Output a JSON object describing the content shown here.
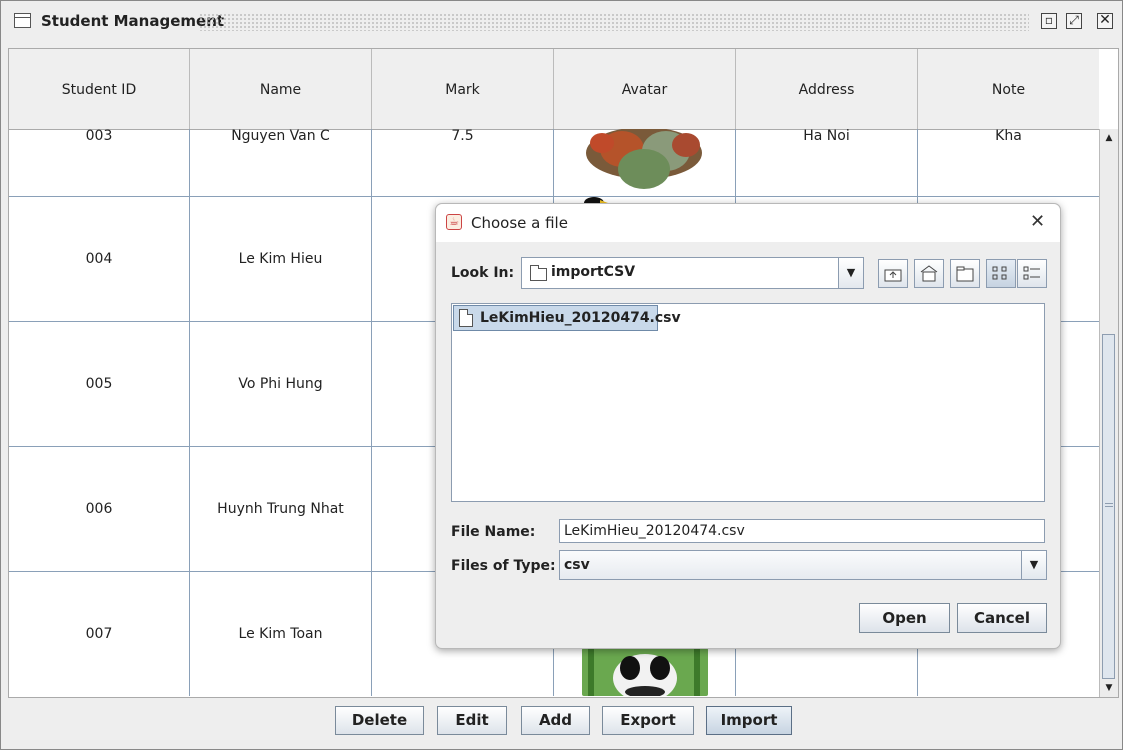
{
  "window": {
    "title": "Student Management",
    "controls": {
      "iconify": "▫",
      "maximize": "⤢",
      "close": "✕"
    }
  },
  "table": {
    "columns": [
      "Student ID",
      "Name",
      "Mark",
      "Avatar",
      "Address",
      "Note"
    ],
    "rows": [
      {
        "id": "003",
        "name": "Nguyen Van C",
        "mark": "7.5",
        "address": "Ha Noi",
        "note": "Kha"
      },
      {
        "id": "004",
        "name": "Le Kim Hieu",
        "mark": "",
        "address": "",
        "note": ""
      },
      {
        "id": "005",
        "name": "Vo Phi Hung",
        "mark": "",
        "address": "",
        "note": ""
      },
      {
        "id": "006",
        "name": "Huynh Trung Nhat",
        "mark": "",
        "address": "",
        "note": ""
      },
      {
        "id": "007",
        "name": "Le Kim Toan",
        "mark": "",
        "address": "",
        "note": ""
      }
    ]
  },
  "buttons": {
    "delete": "Delete",
    "edit": "Edit",
    "add": "Add",
    "export": "Export",
    "import": "Import"
  },
  "dialog": {
    "title": "Choose a file",
    "look_in_label": "Look In:",
    "look_in_value": "importCSV",
    "files": [
      "LeKimHieu_20120474.csv"
    ],
    "file_name_label": "File Name:",
    "file_name_value": "LeKimHieu_20120474.csv",
    "files_of_type_label": "Files of Type:",
    "files_of_type_value": "csv",
    "open_label": "Open",
    "cancel_label": "Cancel"
  },
  "colors": {
    "selection": "#c9d9ea",
    "grid": "#8aa0b8",
    "header_bg": "#efefef"
  }
}
